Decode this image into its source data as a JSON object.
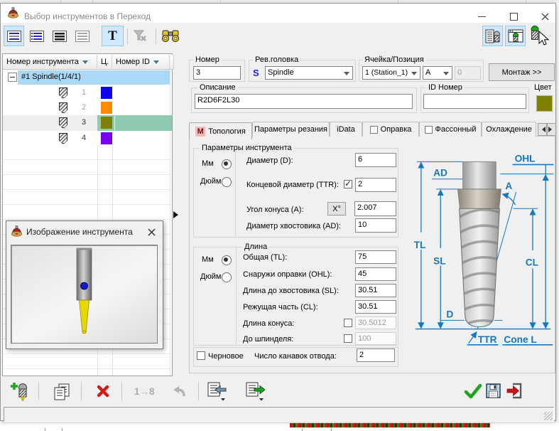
{
  "window": {
    "title": "Выбор инструментов в Переход"
  },
  "main_toolbar": {
    "text_filter_label": "T"
  },
  "tool_table": {
    "columns": [
      "Номер инструмента",
      "Ц.",
      "Номер ID"
    ],
    "group_label": "#1 Spindle(1/4/1)",
    "rows": [
      {
        "num": "1",
        "color": "#0d00f0"
      },
      {
        "num": "2",
        "color": "#ff8a00"
      },
      {
        "num": "3",
        "color": "#7f7f00"
      },
      {
        "num": "4",
        "color": "#7b00f0"
      }
    ],
    "selection_colors": {
      "group_highlight": "#abd9f5",
      "selected_row": "#efefef",
      "selected_cell": "#8fcbb2"
    }
  },
  "tool_image_popup": {
    "title": "Изображение инструмента"
  },
  "header_form": {
    "number_label": "Номер",
    "number_value": "3",
    "revhead_label": "Рев.головка",
    "revhead_prefix": "S",
    "revhead_value": "Spindle",
    "cell_label": "Ячейка/Позиция",
    "cell_station": "1 (Station_1)",
    "cell_pos": "A",
    "cell_extra": "0",
    "mount_button": "Монтаж >>",
    "desc_label": "Описание",
    "desc_value": "R2D6F2L30",
    "id_label": "ID Номер",
    "id_value": "",
    "color_label": "Цвет",
    "color_value": "#7f7f00"
  },
  "tabs": {
    "items": [
      {
        "label": "Топология",
        "badge": "M"
      },
      {
        "label": "Параметры резания"
      },
      {
        "label": "iData"
      },
      {
        "label": "Оправка"
      },
      {
        "label": "Фассонный"
      },
      {
        "label": "Охлаждение"
      }
    ]
  },
  "topology": {
    "group1_title": "Параметры инструмента",
    "units_mm": "Мм",
    "units_inch": "Дюйм",
    "diameter_label": "Диаметр (D):",
    "diameter_value": "6",
    "ttr_label": "Концевой диаметр (TTR):",
    "ttr_value": "2",
    "angle_label": "Угол конуса (A):",
    "angle_button": "X°",
    "angle_value": "2.007",
    "shank_label": "Диаметр хвостовика (AD):",
    "shank_value": "10",
    "group2_title": "Длина",
    "tl_label": "Общая (TL):",
    "tl_value": "75",
    "ohl_label": "Снаружи оправки (OHL):",
    "ohl_value": "45",
    "sl_label": "Длина до хвостовика (SL):",
    "sl_value": "30.51",
    "cl_label": "Режущая часть (CL):",
    "cl_value": "30.51",
    "cone_label": "Длина конуса:",
    "cone_value": "30.5012",
    "spindle_label": "До шпинделя:",
    "spindle_value": "100",
    "rough_label": "Черновое",
    "flutes_label": "Число канавок отвода:",
    "flutes_value": "2"
  },
  "diagram": {
    "accent": "#1878be",
    "labels": {
      "ad": "AD",
      "ohl": "OHL",
      "a": "A",
      "tl": "TL",
      "sl": "SL",
      "cl": "CL",
      "d": "D",
      "ttr": "TTR",
      "cone": "Cone L"
    }
  },
  "bottom_toolbar": {
    "renumber_label": "1→8"
  }
}
